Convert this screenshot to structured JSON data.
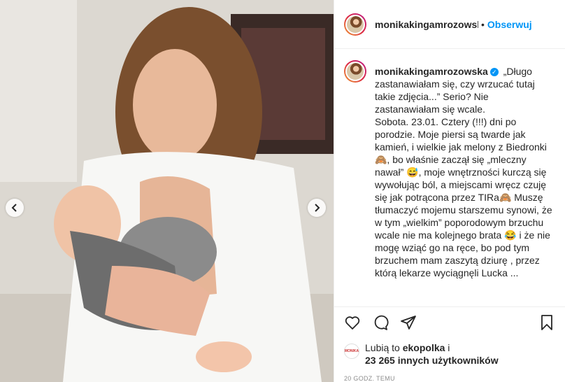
{
  "post": {
    "username": "monikakingamrozowsk",
    "separator": "•",
    "follow_label": "Obserwuj",
    "caption_username": "monikakingamrozowska",
    "verified_symbol": "✓",
    "caption_text": " „Długo zastanawiałam się, czy wrzucać tutaj takie zdjęcia...” Serio? Nie zastanawiałam się wcale.\nSobota. 23.01. Cztery (!!!) dni po porodzie. Moje piersi są twarde jak kamień, i wielkie jak melony z Biedronki🙈, bo właśnie zaczął się „mleczny nawał” 😅, moje wnętrzności kurczą się wywołując ból, a miejscami wręcz czuję się jak potrącona przez TIRa🙈 Muszę tłumaczyć mojemu starszemu synowi, że w tym „wielkim” poporodowym brzuchu wcale nie ma kolejnego brata 😂 i że nie mogę wziąć go na ręce, bo pod tym brzuchem mam zaszytą dziurę , przez którą lekarze wyciągnęli Lucka ...",
    "likes": {
      "avatar_text": "MONIKA",
      "prefix": "Lubią to ",
      "user": "ekopolka",
      "joiner": " i",
      "count": "23 265 innych użytkowników"
    },
    "time": "20 GODZ. TEMU"
  },
  "icons": {
    "like": "heart-icon",
    "comment": "comment-icon",
    "share": "share-icon",
    "save": "bookmark-icon",
    "prev": "chevron-left-icon",
    "next": "chevron-right-icon"
  },
  "colors": {
    "accent": "#0095f6",
    "text": "#262626",
    "muted": "#8e8e8e"
  }
}
